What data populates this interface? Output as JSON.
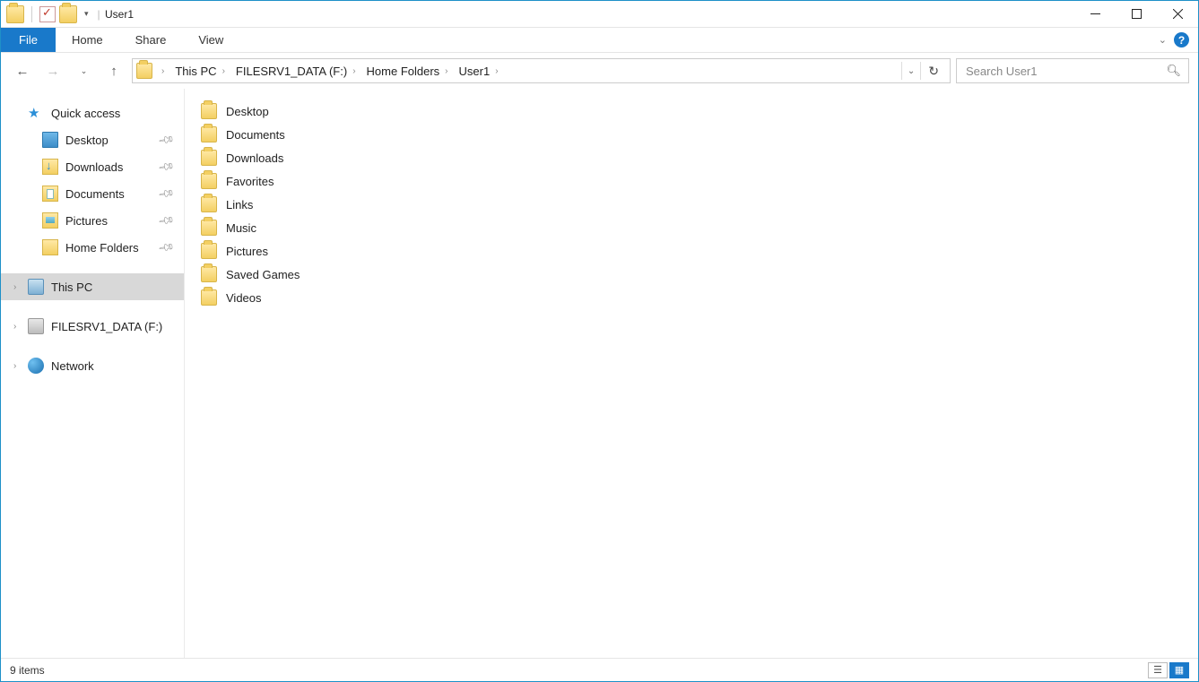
{
  "window": {
    "title": "User1"
  },
  "ribbon": {
    "file": "File",
    "tabs": [
      "Home",
      "Share",
      "View"
    ]
  },
  "breadcrumbs": [
    "This PC",
    "FILESRV1_DATA (F:)",
    "Home Folders",
    "User1"
  ],
  "search": {
    "placeholder": "Search User1"
  },
  "navpane": {
    "quick_access": {
      "label": "Quick access",
      "items": [
        {
          "label": "Desktop",
          "icon": "ico-desktop",
          "pinned": true
        },
        {
          "label": "Downloads",
          "icon": "ico-down",
          "pinned": true
        },
        {
          "label": "Documents",
          "icon": "ico-docs",
          "pinned": true
        },
        {
          "label": "Pictures",
          "icon": "ico-pics",
          "pinned": true
        },
        {
          "label": "Home Folders",
          "icon": "ico-folder",
          "pinned": true
        }
      ]
    },
    "this_pc": {
      "label": "This PC"
    },
    "drive": {
      "label": "FILESRV1_DATA (F:)"
    },
    "network": {
      "label": "Network"
    }
  },
  "files": [
    {
      "name": "Desktop"
    },
    {
      "name": "Documents"
    },
    {
      "name": "Downloads"
    },
    {
      "name": "Favorites"
    },
    {
      "name": "Links"
    },
    {
      "name": "Music"
    },
    {
      "name": "Pictures"
    },
    {
      "name": "Saved Games"
    },
    {
      "name": "Videos"
    }
  ],
  "status": {
    "item_count": "9 items"
  }
}
